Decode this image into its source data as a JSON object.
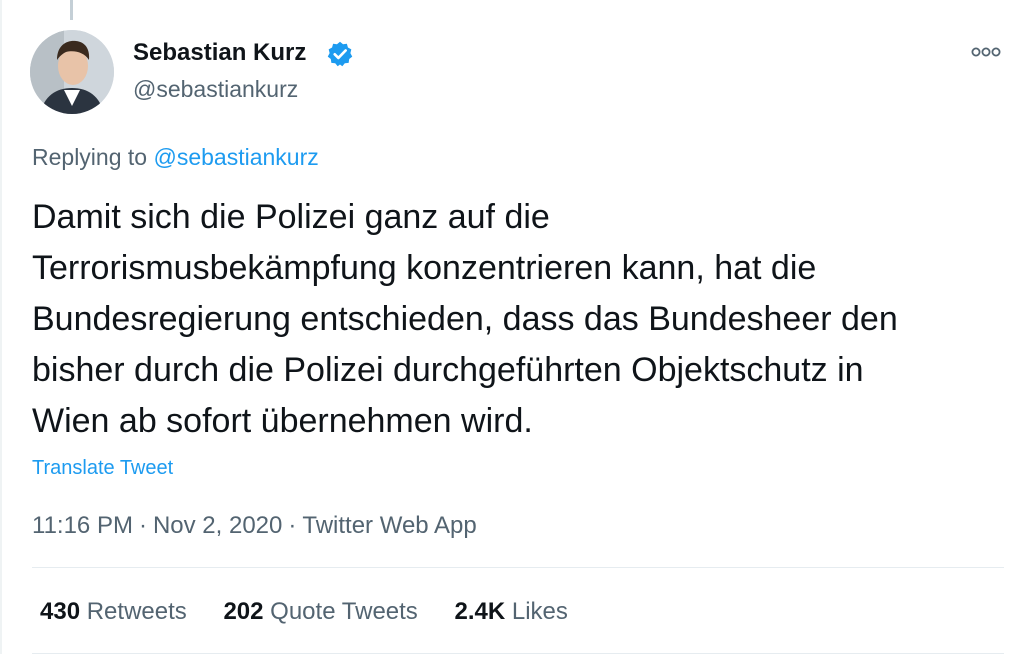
{
  "author": {
    "name": "Sebastian Kurz",
    "handle": "@sebastiankurz",
    "verified": true,
    "avatar_icon": "profile-photo"
  },
  "reply": {
    "prefix": "Replying to",
    "mention": "@sebastiankurz"
  },
  "tweet": {
    "lines": [
      "Damit sich die Polizei ganz auf die",
      "Terrorismusbekämpfung konzentrieren kann, hat die",
      "Bundesregierung entschieden, dass das Bundesheer den",
      "bisher durch die Polizei durchgeführten Objektschutz in",
      "Wien ab sofort übernehmen wird."
    ],
    "translate_label": "Translate Tweet",
    "time": "11:16 PM",
    "date": "Nov 2, 2020",
    "source": "Twitter Web App",
    "separator": "·"
  },
  "stats": [
    {
      "count": "430",
      "label": "Retweets"
    },
    {
      "count": "202",
      "label": "Quote Tweets"
    },
    {
      "count": "2.4K",
      "label": "Likes"
    }
  ],
  "colors": {
    "link": "#1d9bf0",
    "secondary_text": "#536471",
    "primary_text": "#0f1419",
    "verified_badge": "#1d9bf0"
  },
  "icons": {
    "verified": "verified-badge-icon",
    "more": "more-options-icon"
  }
}
